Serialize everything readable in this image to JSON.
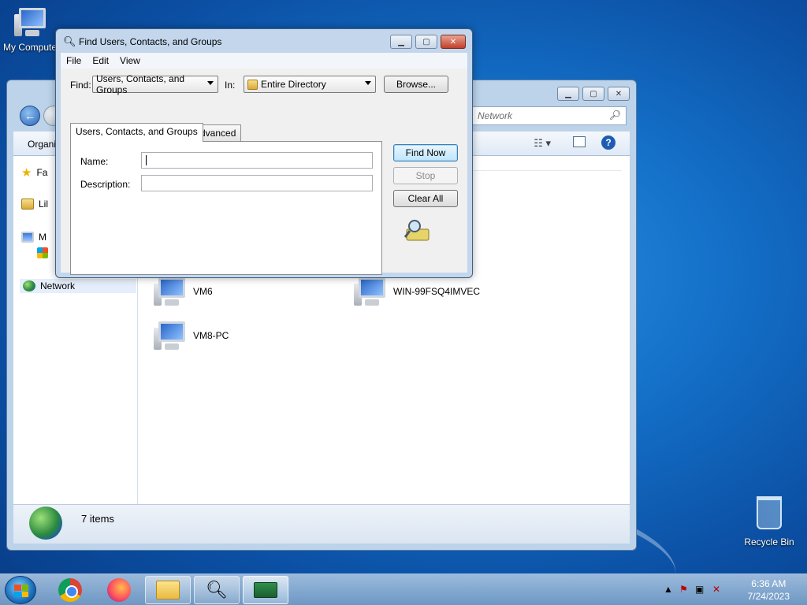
{
  "desktop": {
    "icons": [
      {
        "label": "My Computer"
      },
      {
        "label": "Recycle Bin"
      }
    ]
  },
  "explorer": {
    "search_placeholder": "Network",
    "organize_label": "Organi",
    "nav_items": [
      {
        "label": "Fa"
      },
      {
        "label": "Lil"
      },
      {
        "label": "M"
      },
      {
        "label": "Network"
      }
    ],
    "nodes": [
      {
        "label": "VM6"
      },
      {
        "label": "WIN-99FSQ4IMVEC"
      },
      {
        "label": "VM8-PC"
      }
    ],
    "status_text": "7 items"
  },
  "dialog": {
    "title": "Find Users, Contacts, and Groups",
    "menu": [
      "File",
      "Edit",
      "View"
    ],
    "find_label": "Find:",
    "find_value": "Users, Contacts, and Groups",
    "in_label": "In:",
    "in_value": "Entire Directory",
    "browse_label": "Browse...",
    "tabs": [
      "Users, Contacts, and Groups",
      "Advanced"
    ],
    "name_label": "Name:",
    "name_value": "",
    "description_label": "Description:",
    "description_value": "",
    "find_now_label": "Find Now",
    "stop_label": "Stop",
    "clear_all_label": "Clear All"
  },
  "taskbar": {
    "apps": [
      {
        "icon": "chrome-icon"
      },
      {
        "icon": "firefox-icon"
      },
      {
        "icon": "file-explorer-icon"
      },
      {
        "icon": "find-users-icon"
      },
      {
        "icon": "network-card-icon"
      }
    ],
    "clock_time": "6:36 AM",
    "clock_date": "7/24/2023"
  }
}
